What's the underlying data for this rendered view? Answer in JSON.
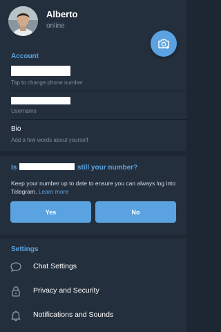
{
  "header": {
    "name": "Alberto",
    "status": "online"
  },
  "account": {
    "title": "Account",
    "phone_hint": "Tap to change phone number",
    "username_hint": "Username",
    "bio_label": "Bio",
    "bio_hint": "Add a few words about yourself"
  },
  "prompt": {
    "title_start": "Is",
    "title_end": "still your number?",
    "body": "Keep your number up to date to ensure you can always log into Telegram.",
    "link": "Learn more",
    "yes_label": "Yes",
    "no_label": "No"
  },
  "settings": {
    "title": "Settings",
    "items": [
      {
        "label": "Chat Settings",
        "icon": "chat-bubble-icon"
      },
      {
        "label": "Privacy and Security",
        "icon": "lock-icon"
      },
      {
        "label": "Notifications and Sounds",
        "icon": "bell-icon"
      }
    ]
  },
  "colors": {
    "accent": "#5aa3e0",
    "background": "#1d2733",
    "card": "#242f3d"
  }
}
